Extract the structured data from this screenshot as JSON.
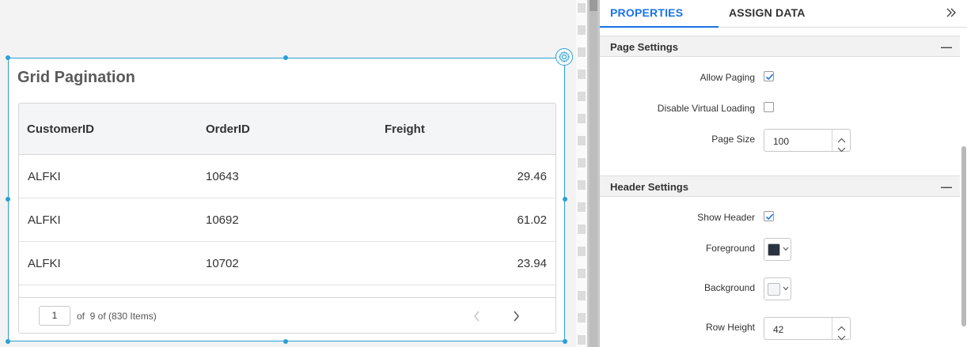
{
  "widget": {
    "title": "Grid Pagination",
    "columns": [
      "CustomerID",
      "OrderID",
      "Freight"
    ],
    "rows": [
      {
        "customer": "ALFKI",
        "order": "10643",
        "freight": "29.46"
      },
      {
        "customer": "ALFKI",
        "order": "10692",
        "freight": "61.02"
      },
      {
        "customer": "ALFKI",
        "order": "10702",
        "freight": "23.94"
      }
    ],
    "pager": {
      "current_page": "1",
      "summary": "of  9 of (830 Items)"
    }
  },
  "panel": {
    "tabs": [
      "PROPERTIES",
      "ASSIGN DATA"
    ],
    "active_tab": "PROPERTIES",
    "page_settings": {
      "title": "Page Settings",
      "allow_paging_label": "Allow Paging",
      "allow_paging": true,
      "disable_virtual_loading_label": "Disable Virtual Loading",
      "disable_virtual_loading": false,
      "page_size_label": "Page Size",
      "page_size": "100"
    },
    "header_settings": {
      "title": "Header Settings",
      "show_header_label": "Show Header",
      "show_header": true,
      "foreground_label": "Foreground",
      "foreground_color": "#2b3340",
      "background_label": "Background",
      "background_color": "#f3f5f7",
      "row_height_label": "Row Height",
      "row_height": "42"
    }
  },
  "colors": {
    "accent": "#1a73e8",
    "selection": "#2a9fd6",
    "check": "#1a73e8"
  }
}
